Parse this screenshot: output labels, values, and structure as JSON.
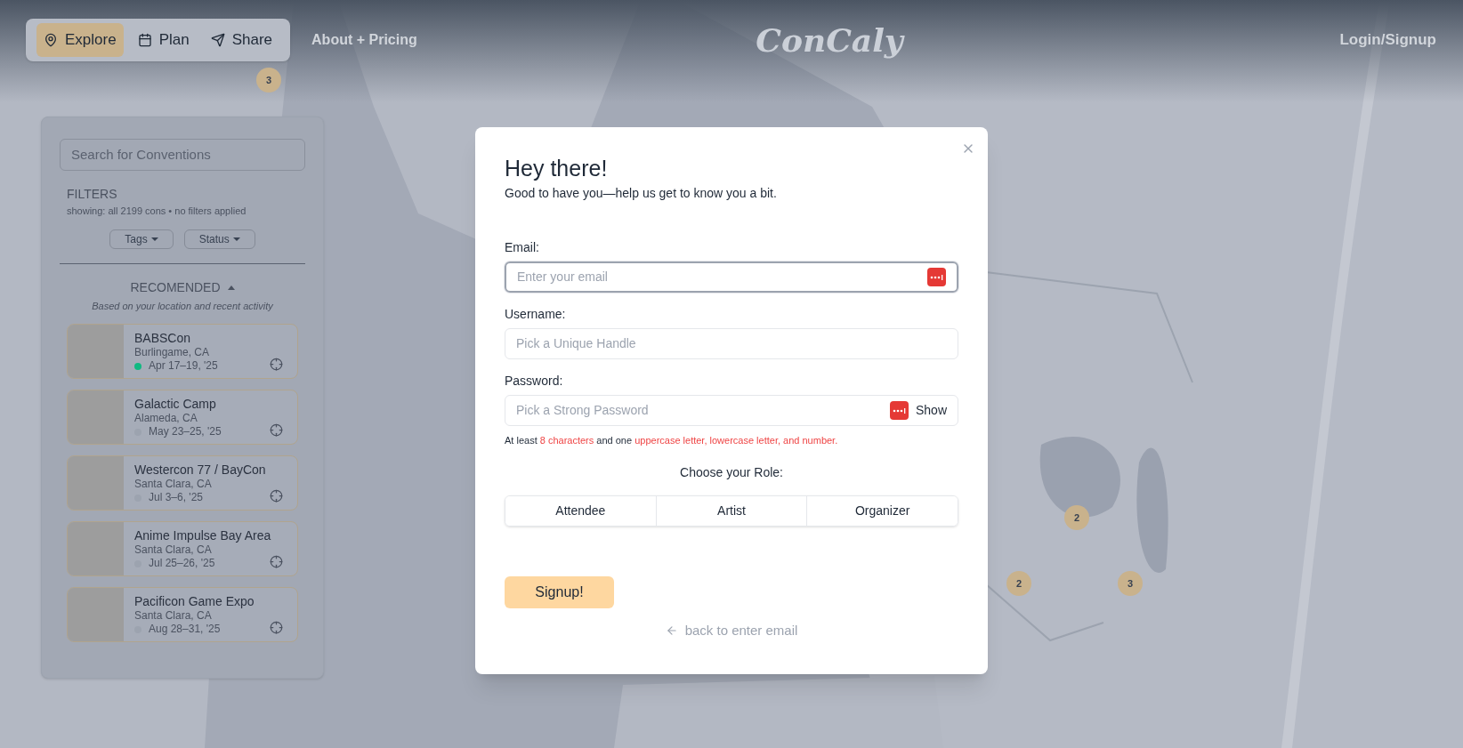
{
  "nav": {
    "tabs": [
      {
        "label": "Explore",
        "selected": true
      },
      {
        "label": "Plan",
        "selected": false
      },
      {
        "label": "Share",
        "selected": false
      }
    ],
    "link": "About + Pricing",
    "logo": "ConCaly",
    "login": "Login/Signup"
  },
  "map_markers": [
    {
      "count": "3"
    },
    {
      "count": "2"
    },
    {
      "count": "2"
    },
    {
      "count": "3"
    }
  ],
  "sidebar": {
    "search": {
      "placeholder": "Search for Conventions"
    },
    "filters_title": "FILTERS",
    "filters_summary": "showing: all 2199 cons • no filters applied",
    "filter_buttons": [
      "Tags",
      "Status"
    ],
    "section": {
      "title": "RECOMENDED",
      "expanded": true,
      "subtitle": "Based on your location and recent activity"
    },
    "cons": [
      {
        "name": "BABSCon",
        "location": "Burlingame, CA",
        "dates": "Apr 17–19, '25",
        "color": "#10b981"
      },
      {
        "name": "Galactic Camp",
        "location": "Alameda, CA",
        "dates": "May 23–25, '25",
        "color": "#9ca3af"
      },
      {
        "name": "Westercon 77 / BayCon",
        "location": "Santa Clara, CA",
        "dates": "Jul 3–6, '25",
        "color": "#9ca3af"
      },
      {
        "name": "Anime Impulse Bay Area",
        "location": "Santa Clara, CA",
        "dates": "Jul 25–26, '25",
        "color": "#9ca3af"
      },
      {
        "name": "Pacificon Game Expo",
        "location": "Santa Clara, CA",
        "dates": "Aug 28–31, '25",
        "color": "#9ca3af"
      }
    ]
  },
  "modal": {
    "title": "Hey there!",
    "subtitle": "Good to have you—help us get to know you a bit.",
    "fields": [
      {
        "label": "Email:",
        "placeholder": "Enter your email",
        "focused": true
      },
      {
        "label": "Username:",
        "placeholder": "Pick a Unique Handle",
        "focused": false
      },
      {
        "label": "Password:",
        "placeholder": "Pick a Strong Password",
        "focused": false,
        "show": "Show"
      }
    ],
    "hint": [
      {
        "text": "At least ",
        "kind": "plain"
      },
      {
        "text": "8 characters",
        "kind": "warn"
      },
      {
        "text": " and one ",
        "kind": "plain"
      },
      {
        "text": "uppercase letter, lowercase letter, and number.",
        "kind": "warn"
      }
    ],
    "role_label": "Choose your Role:",
    "roles": [
      {
        "label": "Attendee",
        "selected": false
      },
      {
        "label": "Artist",
        "selected": false
      },
      {
        "label": "Organizer",
        "selected": false
      }
    ],
    "submit": "Signup!",
    "back": "back to enter email"
  }
}
